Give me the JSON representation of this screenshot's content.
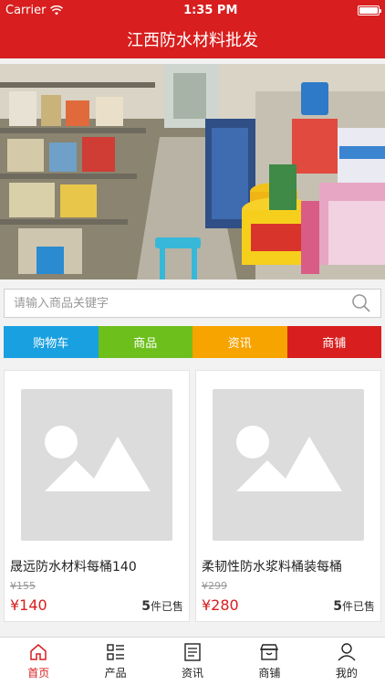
{
  "status": {
    "carrier": "Carrier",
    "time": "1:35 PM"
  },
  "header": {
    "title": "江西防水材料批发"
  },
  "search": {
    "placeholder": "请输入商品关键字"
  },
  "categories": [
    {
      "label": "购物车",
      "color": "#19a0e0"
    },
    {
      "label": "商品",
      "color": "#6dbf1c"
    },
    {
      "label": "资讯",
      "color": "#f7a400"
    },
    {
      "label": "商铺",
      "color": "#d81e1e"
    }
  ],
  "products": [
    {
      "name": "晟远防水材料每桶140",
      "old_price": "¥155",
      "price": "¥140",
      "sold_count": "5",
      "sold_suffix": "件已售"
    },
    {
      "name": "柔韧性防水浆料桶装每桶",
      "old_price": "¥299",
      "price": "¥280",
      "sold_count": "5",
      "sold_suffix": "件已售"
    }
  ],
  "tabs": [
    {
      "label": "首页",
      "icon": "home-icon",
      "active": true
    },
    {
      "label": "产品",
      "icon": "list-icon",
      "active": false
    },
    {
      "label": "资讯",
      "icon": "news-icon",
      "active": false
    },
    {
      "label": "商铺",
      "icon": "shop-icon",
      "active": false
    },
    {
      "label": "我的",
      "icon": "user-icon",
      "active": false
    }
  ],
  "colors": {
    "brand": "#d81e1e",
    "price": "#d81e1e"
  }
}
